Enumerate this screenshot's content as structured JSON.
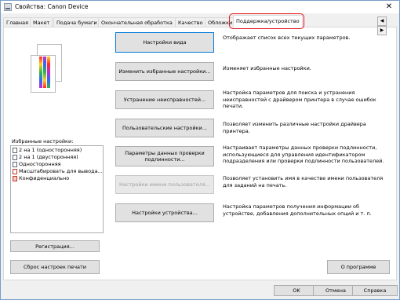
{
  "window": {
    "title": "Свойства: Canon Device",
    "close_glyph": "✕"
  },
  "tabs": [
    "Главная",
    "Макет",
    "Подача бумаги",
    "Окончательная обработка",
    "Качество",
    "Обложки",
    "Поддержка/устройство"
  ],
  "favorites": {
    "label": "Избранные настройки:",
    "items": [
      "2 на 1 (односторонняя)",
      "2 на 1 (двусторонняя)",
      "Односторонняя",
      "Масштабировать для вывода...",
      "Конфиденциально"
    ],
    "register": "Регистрация...",
    "reset": "Сброс настроек печати"
  },
  "actions": [
    {
      "label": "Настройки вида",
      "desc": "Отображает список всех текущих параметров."
    },
    {
      "label": "Изменить избранные настройки...",
      "desc": "Изменяет избранные настройки."
    },
    {
      "label": "Устранение неисправностей...",
      "desc": "Настройка параметров для поиска и устранения неисправностей с драйвером принтера в случае ошибок печати."
    },
    {
      "label": "Пользовательские настройки...",
      "desc": "Позволяет изменить различные настройки драйвера принтера."
    },
    {
      "label": "Параметры данных проверки подлинности...",
      "desc": "Настраивает параметры данных проверки подлинности, использующиеся для управления идентификатором подразделения или проверки подлинности пользователей."
    },
    {
      "label": "Настройки имени пользователя...",
      "desc": "Позволяет установить имя в качестве имени пользователя для заданий на печать."
    },
    {
      "label": "Настройки устройства...",
      "desc": "Настройка параметров получения информации об устройстве, добавления дополнительных опций и т. п."
    }
  ],
  "about": "О программе",
  "footer": {
    "ok": "OK",
    "cancel": "Отмена",
    "help": "Справка"
  },
  "scroll_left": "◀",
  "scroll_right": "▶"
}
